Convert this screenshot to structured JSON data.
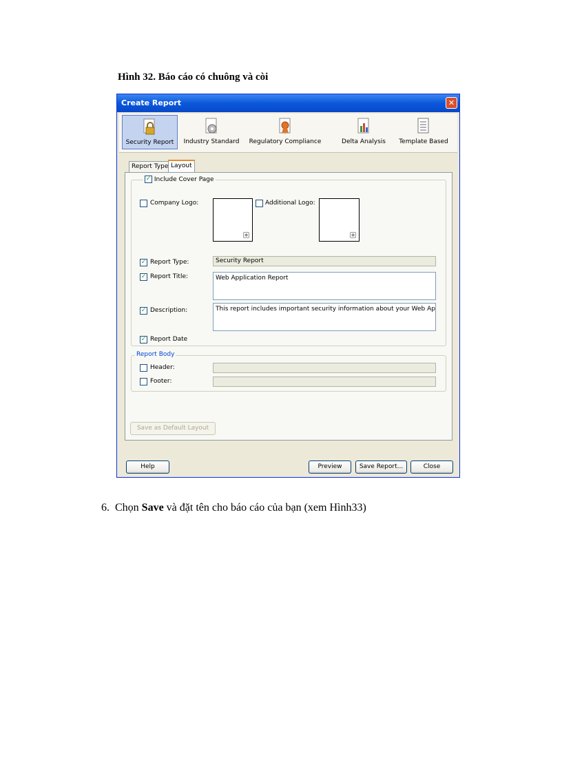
{
  "caption": "Hình 32. Báo cáo có chuông và còi",
  "dialog": {
    "title": "Create Report",
    "toolbar": [
      {
        "label": "Security Report",
        "icon": "lock-icon",
        "selected": true
      },
      {
        "label": "Industry Standard",
        "icon": "gear-document-icon",
        "selected": false
      },
      {
        "label": "Regulatory Compliance",
        "icon": "ribbon-document-icon",
        "selected": false
      },
      {
        "label": "Delta Analysis",
        "icon": "chart-document-icon",
        "selected": false
      },
      {
        "label": "Template Based",
        "icon": "template-document-icon",
        "selected": false
      }
    ],
    "tabs": {
      "report_type": "Report Type",
      "layout": "Layout"
    },
    "layout": {
      "include_cover_page": "Include Cover Page",
      "company_logo": "Company Logo:",
      "additional_logo": "Additional Logo:",
      "report_type_label": "Report Type:",
      "report_type_value": "Security Report",
      "report_title_label": "Report Title:",
      "report_title_value": "Web Application Report",
      "description_label": "Description:",
      "description_value": "This report includes important security information about your Web Application.",
      "report_date": "Report Date",
      "report_body": "Report Body",
      "header": "Header:",
      "footer": "Footer:"
    },
    "buttons": {
      "save_default": "Save as Default Layout",
      "help": "Help",
      "preview": "Preview",
      "save_report": "Save Report...",
      "close": "Close"
    },
    "colors": {
      "titlebar": "#0a58dc",
      "check": "#21a121",
      "active_tab": "#e68b2c"
    }
  },
  "step": {
    "number": "6.",
    "prefix": "Chọn",
    "bold": "Save",
    "suffix": "và đặt tên cho báo cáo của bạn (xem Hình33)"
  }
}
